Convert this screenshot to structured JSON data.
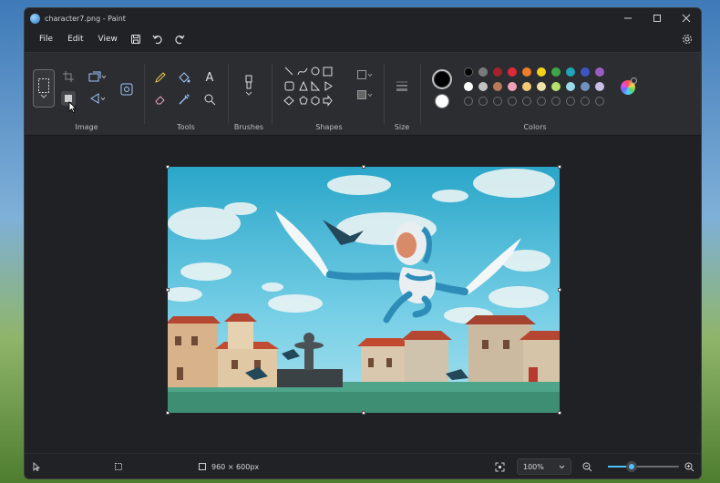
{
  "window": {
    "title": "character7.png - Paint"
  },
  "menu": {
    "file": "File",
    "edit": "Edit",
    "view": "View"
  },
  "ribbon": {
    "groups": {
      "image": "Image",
      "tools": "Tools",
      "brushes": "Brushes",
      "shapes": "Shapes",
      "size": "Size",
      "colors": "Colors"
    },
    "text_tool_glyph": "A",
    "primary_color": "#000000",
    "secondary_color": "#ffffff",
    "palette_row1": [
      "#000000",
      "#7a7a7a",
      "#a3222e",
      "#e3283b",
      "#f07d2a",
      "#f5d11b",
      "#3ea64a",
      "#21a4b8",
      "#3c55c4",
      "#9d5cc4"
    ],
    "palette_row2": [
      "#ffffff",
      "#c3c3c3",
      "#b97a57",
      "#f0a1b8",
      "#f6c777",
      "#efe4a6",
      "#b5e06c",
      "#99d9ea",
      "#7092be",
      "#c8bfe7"
    ]
  },
  "status": {
    "canvas_size": "960 × 600px",
    "zoom": "100%",
    "zoom_percent": 33
  }
}
